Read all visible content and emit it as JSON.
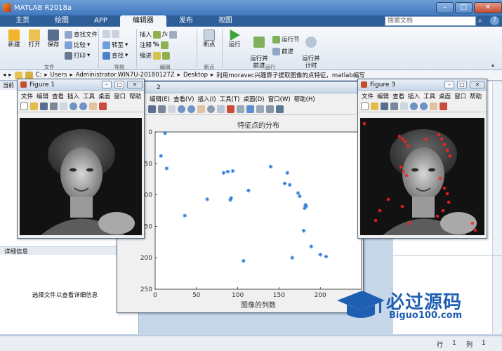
{
  "app": {
    "title": "MATLAB R2018a",
    "tabs": [
      "主页",
      "绘图",
      "APP",
      "编辑器",
      "发布",
      "视图"
    ],
    "active_tab": "编辑器",
    "search_placeholder": "搜索文档"
  },
  "ribbon": {
    "file": {
      "new": "新建",
      "open": "打开",
      "save": "保存",
      "find_files": "查找文件",
      "compare": "比较",
      "print": "打印",
      "group": "文件"
    },
    "navigate": {
      "goto": "转至",
      "find": "查找",
      "group": "导航"
    },
    "edit": {
      "insert": "插入",
      "comment": "注释",
      "indent": "缩进",
      "fx": "fx",
      "group": "编辑"
    },
    "breakpoints": {
      "breakpoint": "断点",
      "group": "断点"
    },
    "run": {
      "run": "运行",
      "run_advance": "运行并\n前进",
      "run_section": "运行节",
      "advance": "前进",
      "run_time": "运行并\n计时",
      "group": "运行"
    }
  },
  "address": {
    "parts": [
      "C:",
      "Users",
      "Administrator.WIN7U-20180127Z",
      "Desktop",
      "利用moravec兴趣算子提取图像的点特征，matlab编写"
    ],
    "separator": "▸"
  },
  "left_pane": {
    "header": "当前",
    "details_label": "详细信息",
    "details_hint": "选择文件以查看详细信息"
  },
  "status": {
    "row_label": "行",
    "row": "1",
    "col_label": "列",
    "col": "1"
  },
  "figure1": {
    "title": "Figure 1",
    "menu": [
      "文件",
      "编辑",
      "查看",
      "插入",
      "工具",
      "桌面",
      "窗口",
      "帮助"
    ]
  },
  "figure2": {
    "title": "2",
    "menu": [
      "编辑(E)",
      "查看(V)",
      "插入(I)",
      "工具(T)",
      "桌面(D)",
      "窗口(W)",
      "帮助(H)"
    ],
    "plot_title": "特征点的分布",
    "xlabel": "图像的列数"
  },
  "figure3": {
    "title": "Figure 3",
    "menu": [
      "文件",
      "编辑",
      "查看",
      "插入",
      "工具",
      "桌面",
      "窗口",
      "帮助"
    ]
  },
  "watermark": {
    "name": "必过源码",
    "url": "Biguo100.com"
  },
  "chart_data": {
    "type": "scatter",
    "title": "特征点的分布",
    "xlabel": "图像的列数",
    "ylabel": "",
    "xlim": [
      0,
      250
    ],
    "ylim": [
      0,
      250
    ],
    "y_reversed": true,
    "x_ticks": [
      0,
      50,
      100,
      150,
      200
    ],
    "y_ticks": [
      0,
      50,
      100,
      150,
      200,
      250
    ],
    "marker": "*",
    "color": "#2b7bd6",
    "x": [
      12,
      7,
      14,
      94,
      88,
      83,
      140,
      160,
      157,
      163,
      173,
      181,
      182,
      175,
      180,
      183,
      200,
      207,
      113,
      92,
      91,
      63,
      36,
      107,
      166,
      189
    ],
    "y": [
      2,
      38,
      58,
      62,
      63,
      65,
      55,
      65,
      82,
      84,
      97,
      121,
      116,
      102,
      157,
      118,
      195,
      198,
      93,
      105,
      108,
      107,
      133,
      205,
      200,
      182
    ]
  }
}
